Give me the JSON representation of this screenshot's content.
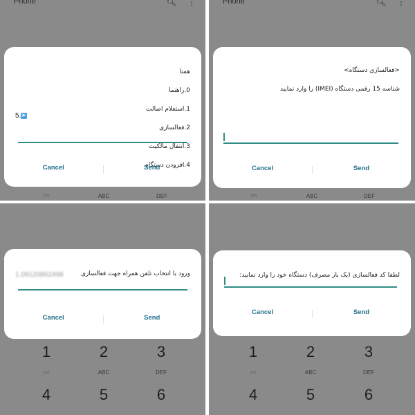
{
  "panels": [
    {
      "app_title": "Phone",
      "dialog": {
        "lines": [
          "همتا",
          "0.راهنما",
          "1.استعلام اصالت",
          "2.فعالسازی",
          "3.انتقال مالکیت",
          "4.افزودن دستگاه"
        ],
        "input_value": "5.",
        "cancel_label": "Cancel",
        "send_label": "Send"
      },
      "keypad_partial": [
        "ABC",
        "DEF"
      ]
    },
    {
      "app_title": "Phone",
      "dialog": {
        "lines": [
          "<فعالسازی دستگاه>",
          "شناسه 15 رقمی دستگاه (IMEI) را وارد نمایید"
        ],
        "cancel_label": "Cancel",
        "send_label": "Send"
      },
      "keypad_partial": [
        "ABC",
        "DEF"
      ]
    },
    {
      "dialog": {
        "lines": [
          "ورود با انتخاب تلفن همراه جهت فعالسازی"
        ],
        "list_item": "1.09120862498",
        "cancel_label": "Cancel",
        "send_label": "Send"
      },
      "keypad": {
        "row1": [
          "1",
          "2",
          "3"
        ],
        "row1_sub": [
          "",
          "ABC",
          "DEF"
        ],
        "row2": [
          "4",
          "5",
          "6"
        ]
      }
    },
    {
      "dialog": {
        "lines": [
          "لطفا کد فعالسازی (یک بار مصرف) دستگاه خود را وارد نمایید:"
        ],
        "cancel_label": "Cancel",
        "send_label": "Send"
      },
      "keypad": {
        "row1": [
          "1",
          "2",
          "3"
        ],
        "row1_sub": [
          "",
          "ABC",
          "DEF"
        ],
        "row2": [
          "4",
          "5",
          "6"
        ]
      }
    }
  ]
}
